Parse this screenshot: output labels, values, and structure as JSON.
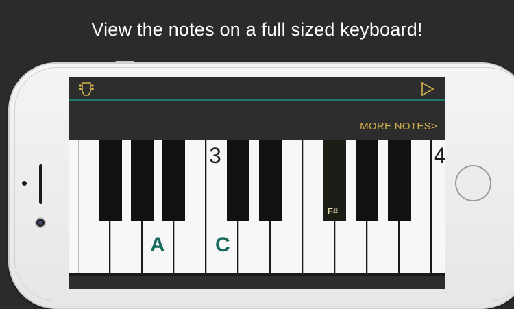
{
  "headline": "View the notes on a full sized keyboard!",
  "toolbar": {
    "left_icon": "tuner-headstock-icon",
    "right_icon": "play-icon",
    "accent_color": "#1d7a6b"
  },
  "more_notes_label": "MORE NOTES>",
  "keyboard": {
    "octave_labels": [
      "3",
      "4"
    ],
    "highlighted_notes": [
      "A",
      "C"
    ],
    "highlighted_sharp": "F#",
    "note_color": "#166b5d",
    "link_color": "#d4b24e"
  }
}
